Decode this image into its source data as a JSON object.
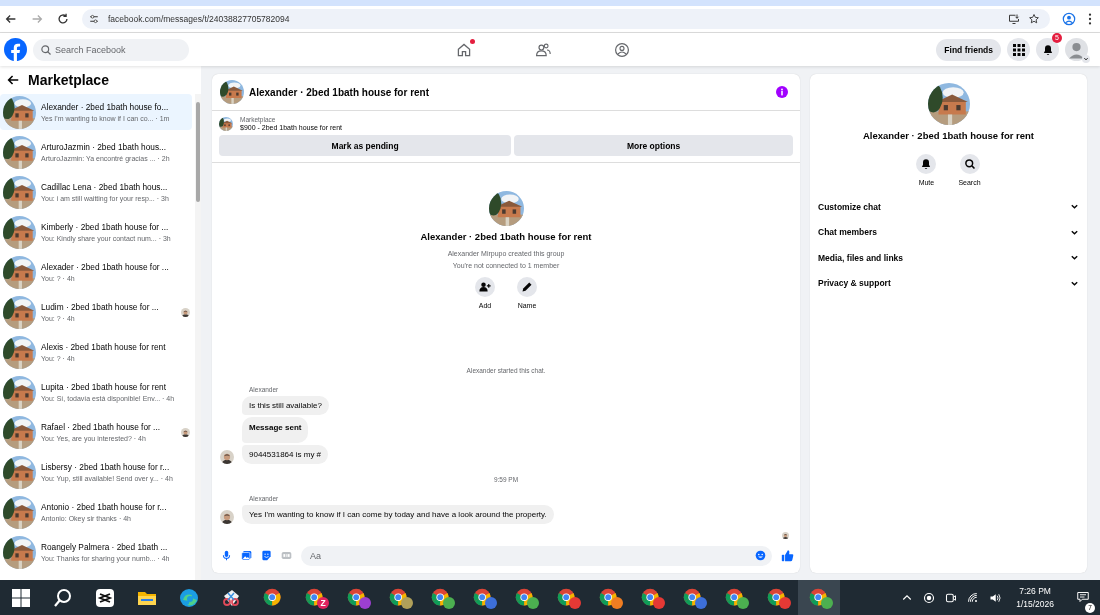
{
  "browser": {
    "url": "facebook.com/messages/t/24038827705782094"
  },
  "header": {
    "search_placeholder": "Search Facebook",
    "home_dot": true,
    "find_friends": "Find friends",
    "notification_count": "5"
  },
  "sidebar": {
    "title": "Marketplace",
    "conversations": [
      {
        "title": "Alexander · 2bed 1bath house fo...",
        "preview": "Yes I'm wanting to know if I can co...",
        "time": "· 1m",
        "selected": true,
        "seen": false
      },
      {
        "title": "ArturoJazmin · 2bed 1bath hous...",
        "preview": "ArturoJazmin: Ya encontré gracias ...",
        "time": "· 2h",
        "selected": false,
        "seen": false
      },
      {
        "title": "Cadillac Lena · 2bed 1bath hous...",
        "preview": "You: i am still waitting for your resp...",
        "time": "· 3h",
        "selected": false,
        "seen": false
      },
      {
        "title": "Kimberly · 2bed 1bath house for ...",
        "preview": "You: Kindly share your contact num...",
        "time": "· 3h",
        "selected": false,
        "seen": false
      },
      {
        "title": "Alexader · 2bed 1bath house for ...",
        "preview": "You: ?",
        "time": "· 4h",
        "selected": false,
        "seen": false
      },
      {
        "title": "Ludim · 2bed 1bath house for ...",
        "preview": "You: ?",
        "time": "· 4h",
        "selected": false,
        "seen": true
      },
      {
        "title": "Alexis · 2bed 1bath house for rent",
        "preview": "You: ?",
        "time": "· 4h",
        "selected": false,
        "seen": false
      },
      {
        "title": "Lupita · 2bed 1bath house for rent",
        "preview": "You: Sí, todavía está disponible! Env...",
        "time": "· 4h",
        "selected": false,
        "seen": false
      },
      {
        "title": "Rafael · 2bed 1bath house for ...",
        "preview": "You: Yes, are you interested?",
        "time": "· 4h",
        "selected": false,
        "seen": true
      },
      {
        "title": "Lisbersy · 2bed 1bath house for r...",
        "preview": "You: Yup, still available! Send over y...",
        "time": "· 4h",
        "selected": false,
        "seen": false
      },
      {
        "title": "Antonio · 2bed 1bath house for r...",
        "preview": "Antonio: Okey sir thanks",
        "time": "· 4h",
        "selected": false,
        "seen": false
      },
      {
        "title": "Roangely Palmera · 2bed 1bath ...",
        "preview": "You: Thanks for sharing your numb...",
        "time": "· 4h",
        "selected": false,
        "seen": false
      }
    ]
  },
  "chat": {
    "title": "Alexander · 2bed 1bath house for rent",
    "listing": {
      "label": "Marketplace",
      "text": "$900 - 2bed 1bath house for rent"
    },
    "buttons": [
      "Mark as pending",
      "More options"
    ],
    "intro": {
      "title": "Alexander · 2bed 1bath house for rent",
      "lines": [
        "Alexander Mirpupo created this group",
        "You're not connected to 1 member"
      ],
      "actions": [
        {
          "kind": "add",
          "label": "Add"
        },
        {
          "kind": "edit",
          "label": "Name"
        }
      ]
    },
    "messages": [
      {
        "kind": "system",
        "text": "Alexander started this chat."
      },
      {
        "kind": "sender",
        "text": "Alexander"
      },
      {
        "kind": "bubble",
        "text": "Is this still available?",
        "bold": false,
        "avatar": false
      },
      {
        "kind": "bubble",
        "text": "Message sent",
        "bold": true,
        "avatar": false
      },
      {
        "kind": "bubble",
        "text": "9044531864 is my #",
        "bold": false,
        "avatar": true
      },
      {
        "kind": "time",
        "text": "9:59 PM"
      },
      {
        "kind": "sender",
        "text": "Alexander"
      },
      {
        "kind": "bubble",
        "text": "Yes I'm wanting to know if I can come by today and have a look around the property.",
        "bold": false,
        "avatar": true
      },
      {
        "kind": "seen"
      }
    ],
    "composer": {
      "placeholder": "Aa"
    }
  },
  "details": {
    "title": "Alexander · 2bed 1bath house for rent",
    "actions": [
      {
        "kind": "mute",
        "label": "Mute"
      },
      {
        "kind": "search",
        "label": "Search"
      }
    ],
    "sections": [
      "Customize chat",
      "Chat members",
      "Media, files and links",
      "Privacy & support"
    ]
  },
  "taskbar": {
    "apps": [
      {
        "kind": "windows",
        "selected": false
      },
      {
        "kind": "search",
        "selected": false
      },
      {
        "kind": "capcut",
        "selected": false
      },
      {
        "kind": "folder",
        "selected": false
      },
      {
        "kind": "edge",
        "selected": false
      },
      {
        "kind": "snip",
        "selected": false
      },
      {
        "kind": "chrome",
        "selected": false
      },
      {
        "kind": "profile",
        "color": "#e0245e",
        "badge": "Z",
        "selected": false
      },
      {
        "kind": "profile",
        "color": "#9c3fd0",
        "selected": false
      },
      {
        "kind": "profile",
        "color": "#b0a05a",
        "selected": false
      },
      {
        "kind": "profile",
        "color": "#4caf50",
        "selected": false
      },
      {
        "kind": "profile",
        "color": "#3d6fd9",
        "selected": false
      },
      {
        "kind": "profile",
        "color": "#4caf50",
        "selected": false
      },
      {
        "kind": "profile",
        "color": "#e53935",
        "selected": false
      },
      {
        "kind": "profile",
        "color": "#ef7d22",
        "selected": false
      },
      {
        "kind": "profile",
        "color": "#e53935",
        "selected": false
      },
      {
        "kind": "profile",
        "color": "#3d6fd9",
        "selected": false
      },
      {
        "kind": "profile",
        "color": "#4caf50",
        "selected": false
      },
      {
        "kind": "profile",
        "color": "#e53935",
        "selected": false
      },
      {
        "kind": "profile",
        "color": "#4caf50",
        "selected": true
      }
    ],
    "time": "7:26 PM",
    "date": "1/15/2026",
    "notification_count": "7"
  }
}
